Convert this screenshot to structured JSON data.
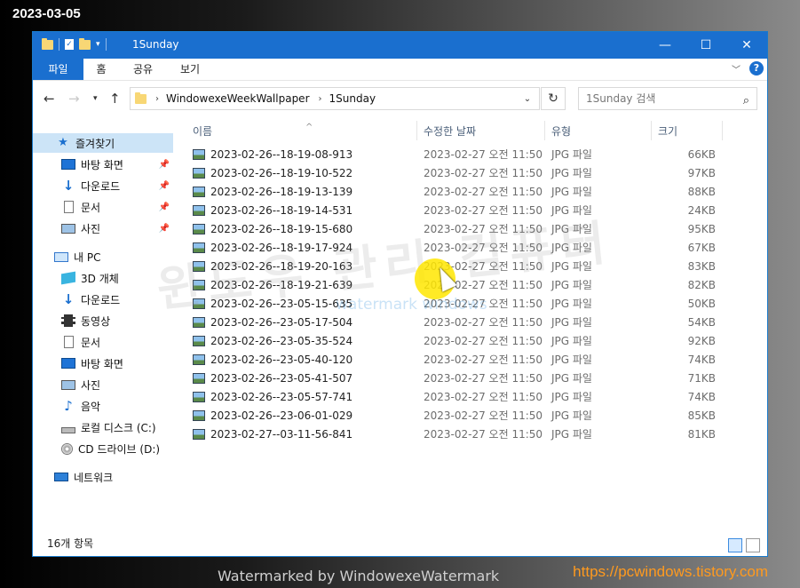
{
  "overlay": {
    "date": "2023-03-05",
    "url": "https://pcwindows.tistory.com",
    "watermark_bottom": "Watermarked by WindowexeWatermark",
    "watermark_big": "윈도우 관리 컴퓨터",
    "watermark_small": "watermark windows"
  },
  "window": {
    "title": "1Sunday",
    "buttons": {
      "minimize": "—",
      "maximize": "☐",
      "close": "✕"
    }
  },
  "ribbon": {
    "tabs": [
      "파일",
      "홈",
      "공유",
      "보기"
    ],
    "help": "?"
  },
  "address": {
    "crumbs": [
      "WindowexeWeekWallpaper",
      "1Sunday"
    ],
    "search_placeholder": "1Sunday 검색"
  },
  "sidebar": {
    "items": [
      {
        "label": "즐겨찾기",
        "icon": "star-icon"
      },
      {
        "label": "바탕 화면",
        "icon": "desktop-icon"
      },
      {
        "label": "다운로드",
        "icon": "download-icon"
      },
      {
        "label": "문서",
        "icon": "document-icon"
      },
      {
        "label": "사진",
        "icon": "picture-icon"
      },
      {
        "label": "내 PC",
        "icon": "pc-icon"
      },
      {
        "label": "3D 개체",
        "icon": "3d-objects-icon"
      },
      {
        "label": "다운로드",
        "icon": "download-icon"
      },
      {
        "label": "동영상",
        "icon": "video-icon"
      },
      {
        "label": "문서",
        "icon": "document-icon"
      },
      {
        "label": "바탕 화면",
        "icon": "desktop-icon"
      },
      {
        "label": "사진",
        "icon": "picture-icon"
      },
      {
        "label": "음악",
        "icon": "music-icon"
      },
      {
        "label": "로컬 디스크 (C:)",
        "icon": "disk-icon"
      },
      {
        "label": "CD 드라이브 (D:)",
        "icon": "cd-drive-icon"
      },
      {
        "label": "네트워크",
        "icon": "network-icon"
      }
    ]
  },
  "columns": {
    "name": "이름",
    "date": "수정한 날짜",
    "type": "유형",
    "size": "크기"
  },
  "files": [
    {
      "name": "2023-02-26--18-19-08-913",
      "date": "2023-02-27 오전 11:50",
      "type": "JPG 파일",
      "size": "66KB"
    },
    {
      "name": "2023-02-26--18-19-10-522",
      "date": "2023-02-27 오전 11:50",
      "type": "JPG 파일",
      "size": "97KB"
    },
    {
      "name": "2023-02-26--18-19-13-139",
      "date": "2023-02-27 오전 11:50",
      "type": "JPG 파일",
      "size": "88KB"
    },
    {
      "name": "2023-02-26--18-19-14-531",
      "date": "2023-02-27 오전 11:50",
      "type": "JPG 파일",
      "size": "24KB"
    },
    {
      "name": "2023-02-26--18-19-15-680",
      "date": "2023-02-27 오전 11:50",
      "type": "JPG 파일",
      "size": "95KB"
    },
    {
      "name": "2023-02-26--18-19-17-924",
      "date": "2023-02-27 오전 11:50",
      "type": "JPG 파일",
      "size": "67KB"
    },
    {
      "name": "2023-02-26--18-19-20-163",
      "date": "2023-02-27 오전 11:50",
      "type": "JPG 파일",
      "size": "83KB"
    },
    {
      "name": "2023-02-26--18-19-21-639",
      "date": "2023-02-27 오전 11:50",
      "type": "JPG 파일",
      "size": "82KB"
    },
    {
      "name": "2023-02-26--23-05-15-635",
      "date": "2023-02-27 오전 11:50",
      "type": "JPG 파일",
      "size": "50KB"
    },
    {
      "name": "2023-02-26--23-05-17-504",
      "date": "2023-02-27 오전 11:50",
      "type": "JPG 파일",
      "size": "54KB"
    },
    {
      "name": "2023-02-26--23-05-35-524",
      "date": "2023-02-27 오전 11:50",
      "type": "JPG 파일",
      "size": "92KB"
    },
    {
      "name": "2023-02-26--23-05-40-120",
      "date": "2023-02-27 오전 11:50",
      "type": "JPG 파일",
      "size": "74KB"
    },
    {
      "name": "2023-02-26--23-05-41-507",
      "date": "2023-02-27 오전 11:50",
      "type": "JPG 파일",
      "size": "71KB"
    },
    {
      "name": "2023-02-26--23-05-57-741",
      "date": "2023-02-27 오전 11:50",
      "type": "JPG 파일",
      "size": "74KB"
    },
    {
      "name": "2023-02-26--23-06-01-029",
      "date": "2023-02-27 오전 11:50",
      "type": "JPG 파일",
      "size": "85KB"
    },
    {
      "name": "2023-02-27--03-11-56-841",
      "date": "2023-02-27 오전 11:50",
      "type": "JPG 파일",
      "size": "81KB"
    }
  ],
  "status": {
    "count": "16개 항목"
  },
  "colors": {
    "accent": "#1a6fcf",
    "selected": "#cce4f7",
    "url": "#ff9a1f"
  }
}
